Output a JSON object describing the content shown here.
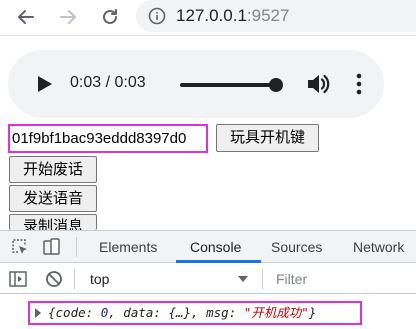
{
  "browser": {
    "url_host": "127.0.0.1",
    "url_port": ":9527"
  },
  "audio_player": {
    "time_display": "0:03 / 0:03",
    "progress": 1.0
  },
  "controls": {
    "token_value": "01f9bf1bac93eddd8397d0",
    "power_on_label": "玩具开机键",
    "start_talk_label": "开始废话",
    "send_voice_label": "发送语音",
    "record_msg_label": "录制消息"
  },
  "devtools": {
    "tabs": [
      "Elements",
      "Console",
      "Sources",
      "Network"
    ],
    "active_tab": "Console",
    "context": "top",
    "filter_placeholder": "Filter",
    "log": {
      "open": "{",
      "code_key": "code",
      "code_val": "0",
      "data_key": "data",
      "data_val": "{…}",
      "msg_key": "msg",
      "msg_val": "\"开机成功\"",
      "close": "}"
    }
  },
  "colors": {
    "highlight_border": "#e030d8",
    "devtools_accent": "#1a73e8"
  }
}
